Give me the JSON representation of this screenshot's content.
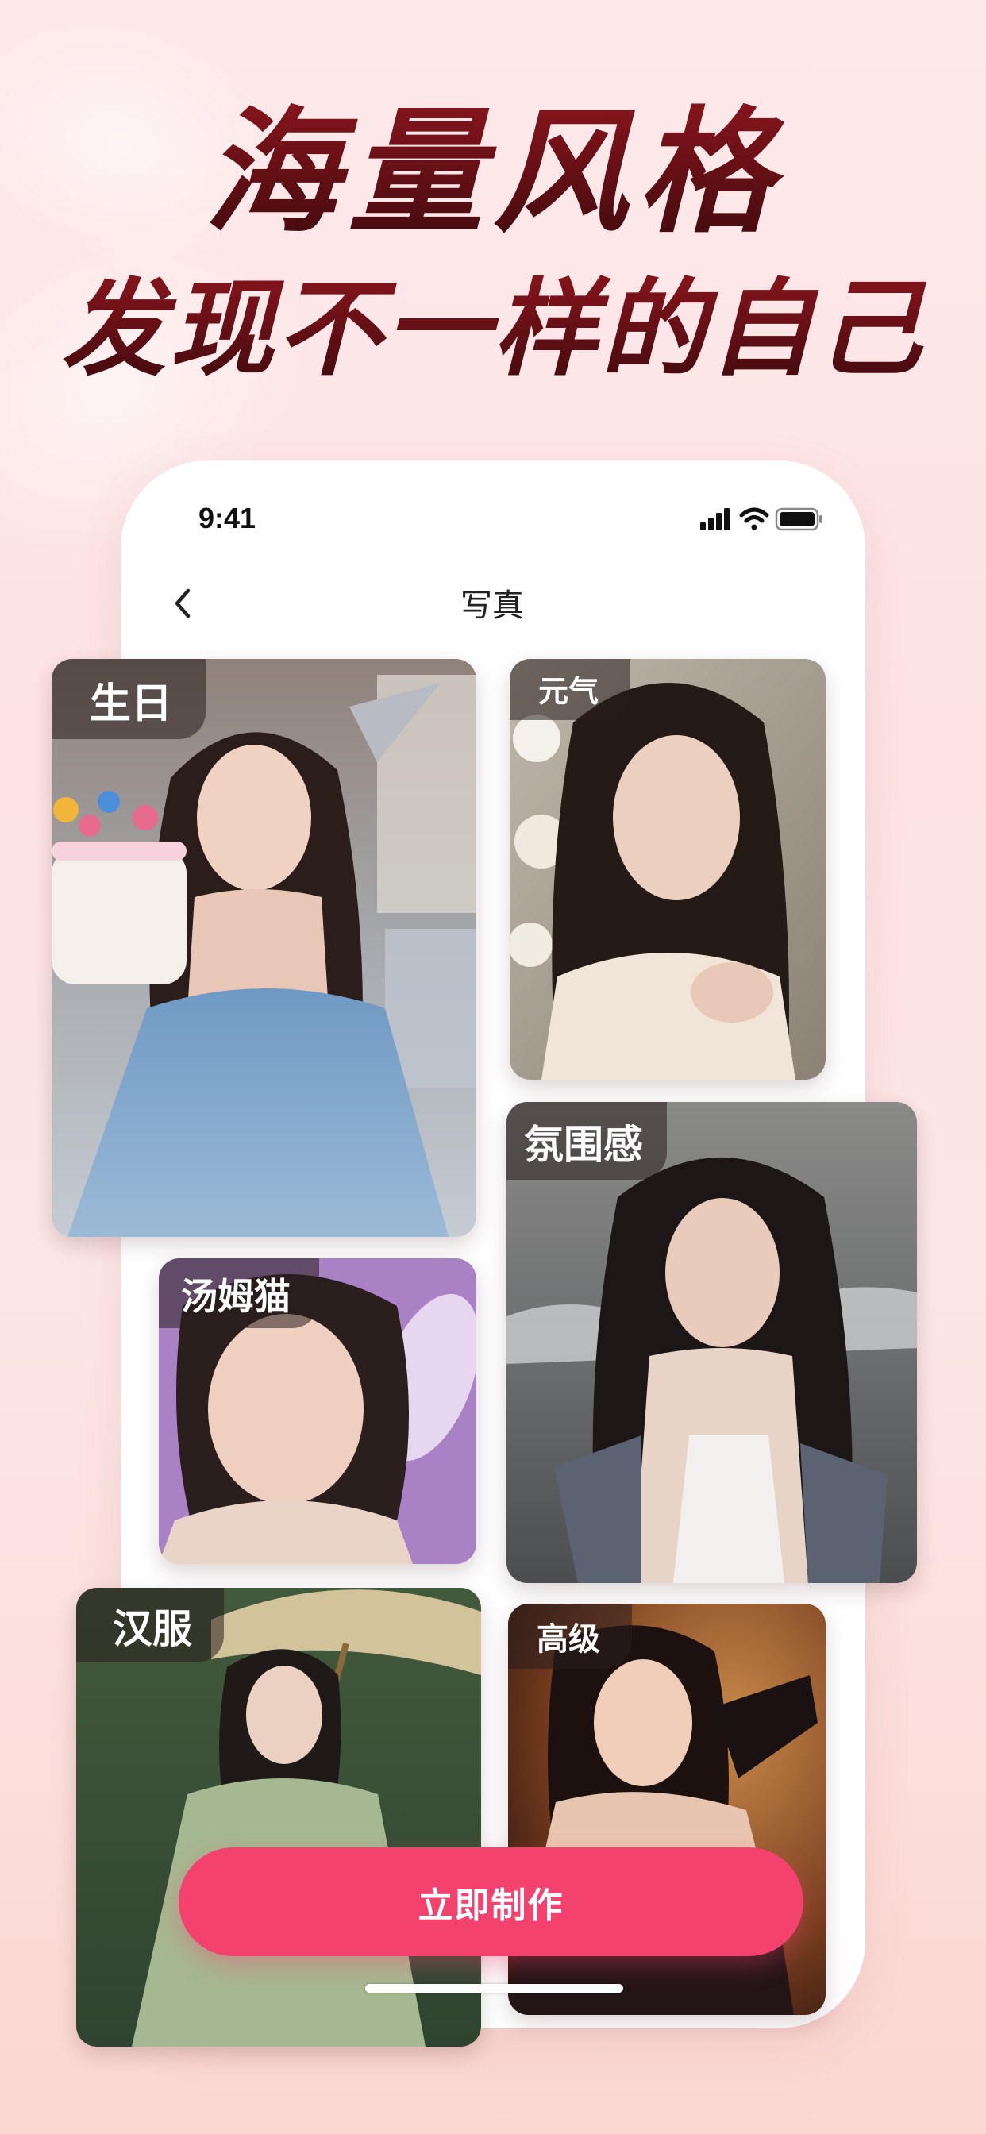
{
  "headline": {
    "line1": "海量风格",
    "line2": "发现不一样的自己"
  },
  "status_bar": {
    "time": "9:41",
    "icons": [
      "signal-icon",
      "wifi-icon",
      "battery-icon"
    ]
  },
  "nav": {
    "back_icon": "chevron-left-icon",
    "title": "写真"
  },
  "styles": [
    {
      "label": "生日"
    },
    {
      "label": "元气"
    },
    {
      "label": "氛围感"
    },
    {
      "label": "汤姆猫"
    },
    {
      "label": "汉服"
    },
    {
      "label": "高级"
    }
  ],
  "cta": {
    "label": "立即制作"
  },
  "colors": {
    "accent": "#f4426f",
    "headline": "#6b0f16",
    "background": "#fde6e6"
  }
}
